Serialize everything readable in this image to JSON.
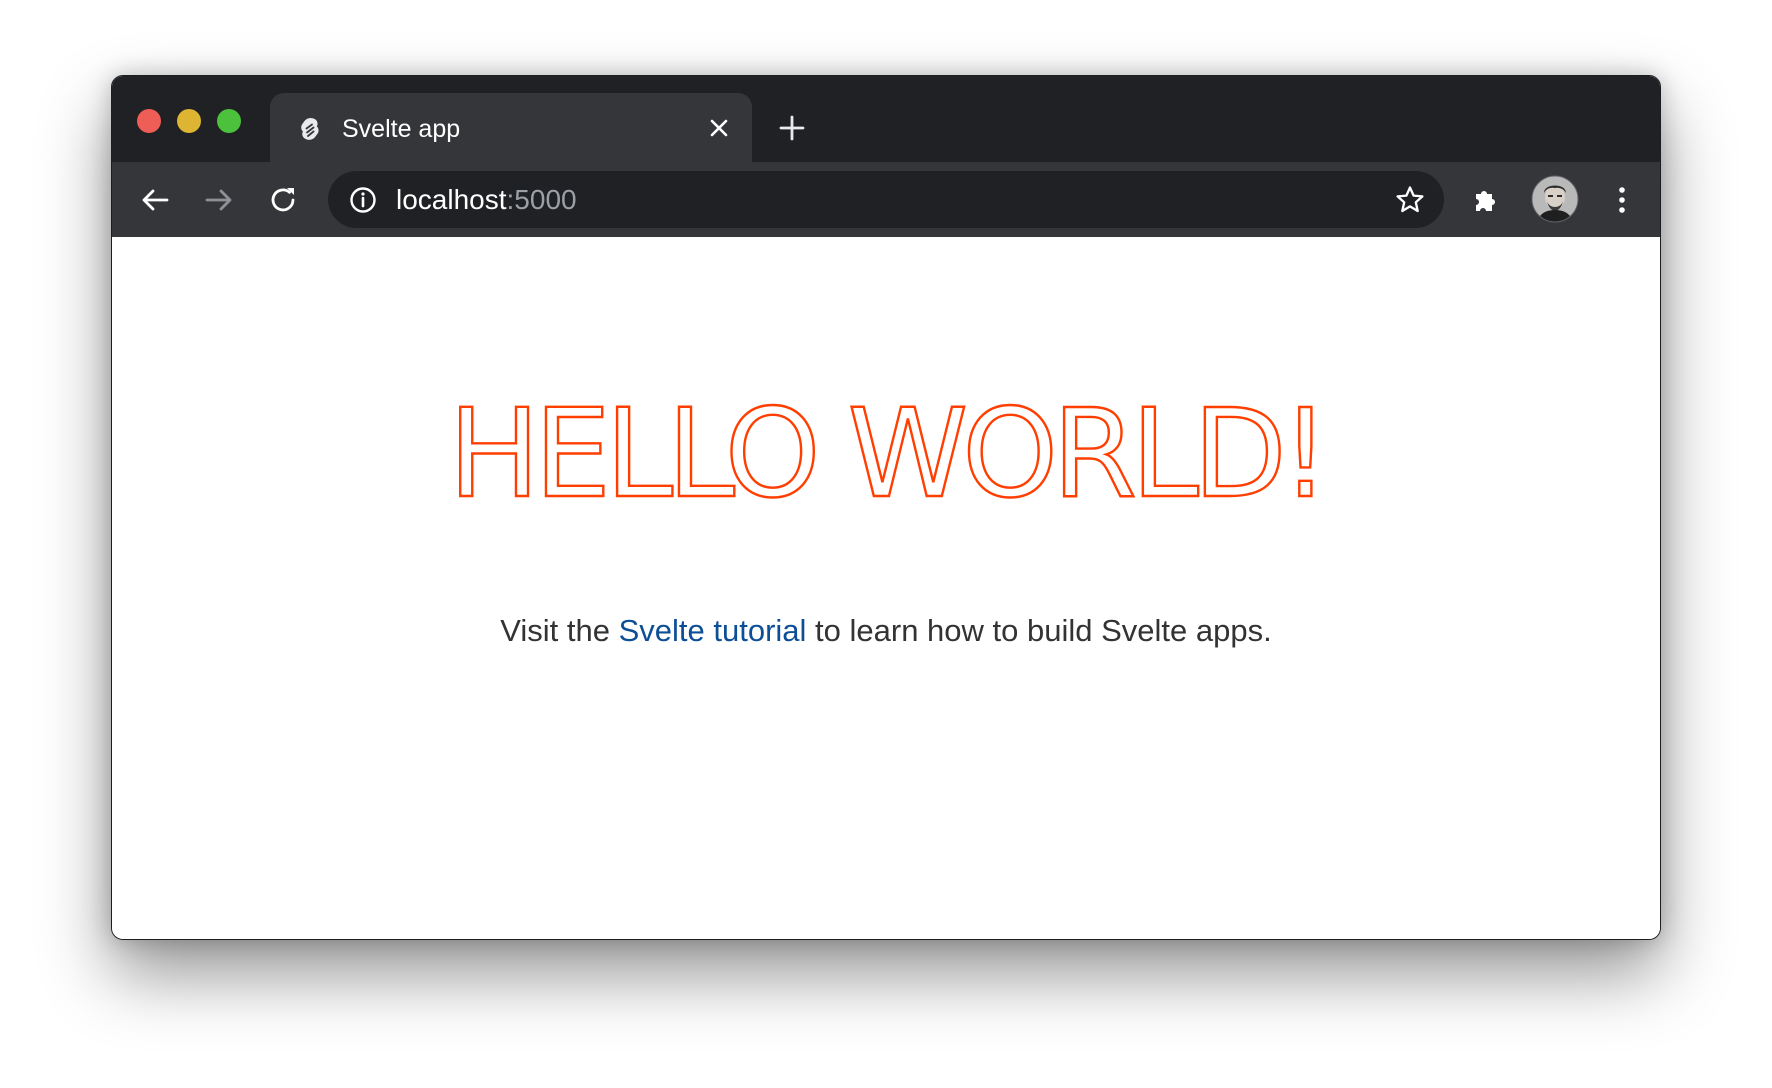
{
  "browser": {
    "tab": {
      "title": "Svelte app",
      "favicon": "svelte-logo-icon",
      "close_icon": "close-icon"
    },
    "new_tab_icon": "plus-icon",
    "nav": {
      "back_icon": "arrow-left-icon",
      "forward_icon": "arrow-right-icon",
      "reload_icon": "reload-icon"
    },
    "address": {
      "host": "localhost",
      "port": ":5000",
      "info_icon": "info-icon",
      "bookmark_icon": "star-icon"
    },
    "extensions_icon": "puzzle-icon",
    "profile_icon": "avatar",
    "menu_icon": "kebab-menu-icon"
  },
  "page": {
    "heading": "Hello world!",
    "intro_before": "Visit the ",
    "link_text": "Svelte tutorial",
    "intro_after": " to learn how to build Svelte apps."
  },
  "colors": {
    "heading": "#ff3e00",
    "link": "#0d4f96",
    "tab_strip": "#202124",
    "toolbar": "#35363a"
  }
}
